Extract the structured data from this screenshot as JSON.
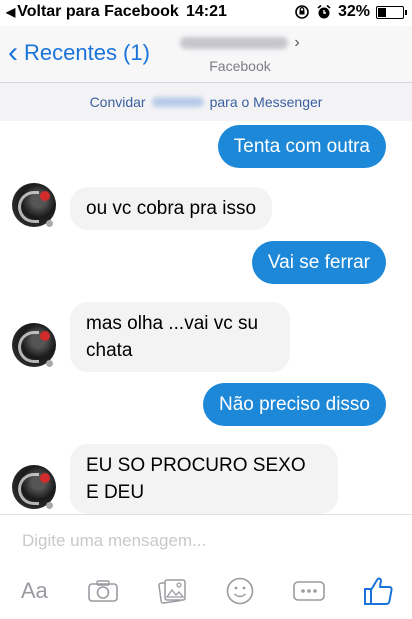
{
  "status_bar": {
    "back_label": "Voltar para Facebook",
    "time": "14:21",
    "battery": "32%",
    "battery_level": 0.32
  },
  "nav": {
    "back_label": "Recentes (1)",
    "subtitle": "Facebook"
  },
  "invite": {
    "prefix": "Convidar",
    "suffix": "para o Messenger"
  },
  "messages": [
    {
      "dir": "sent",
      "text": "Tenta com outra"
    },
    {
      "dir": "recv",
      "text": "ou vc  cobra pra isso"
    },
    {
      "dir": "sent",
      "text": "Vai se ferrar"
    },
    {
      "dir": "recv",
      "text": "mas olha ...vai vc su chata"
    },
    {
      "dir": "sent",
      "text": "Não preciso disso"
    },
    {
      "dir": "recv",
      "text": "EU SO PROCURO SEXO E DEU"
    }
  ],
  "composer": {
    "placeholder": "Digite uma mensagem...",
    "text_tool_label": "Aa"
  },
  "colors": {
    "accent": "#1e88d8",
    "like": "#1a73d9"
  }
}
